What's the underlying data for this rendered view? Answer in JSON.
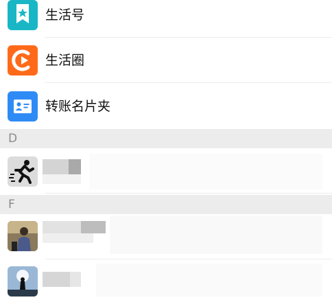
{
  "menu": {
    "items": [
      {
        "label": "生活号",
        "icon": "life-account-icon",
        "color": "#19B7C5"
      },
      {
        "label": "生活圈",
        "icon": "life-circle-icon",
        "color": "#FF6A1A"
      },
      {
        "label": "转账名片夹",
        "icon": "transfer-card-folder-icon",
        "color": "#2E8BF5"
      }
    ]
  },
  "contacts": {
    "sections": [
      {
        "letter": "D"
      },
      {
        "letter": "F"
      }
    ]
  }
}
